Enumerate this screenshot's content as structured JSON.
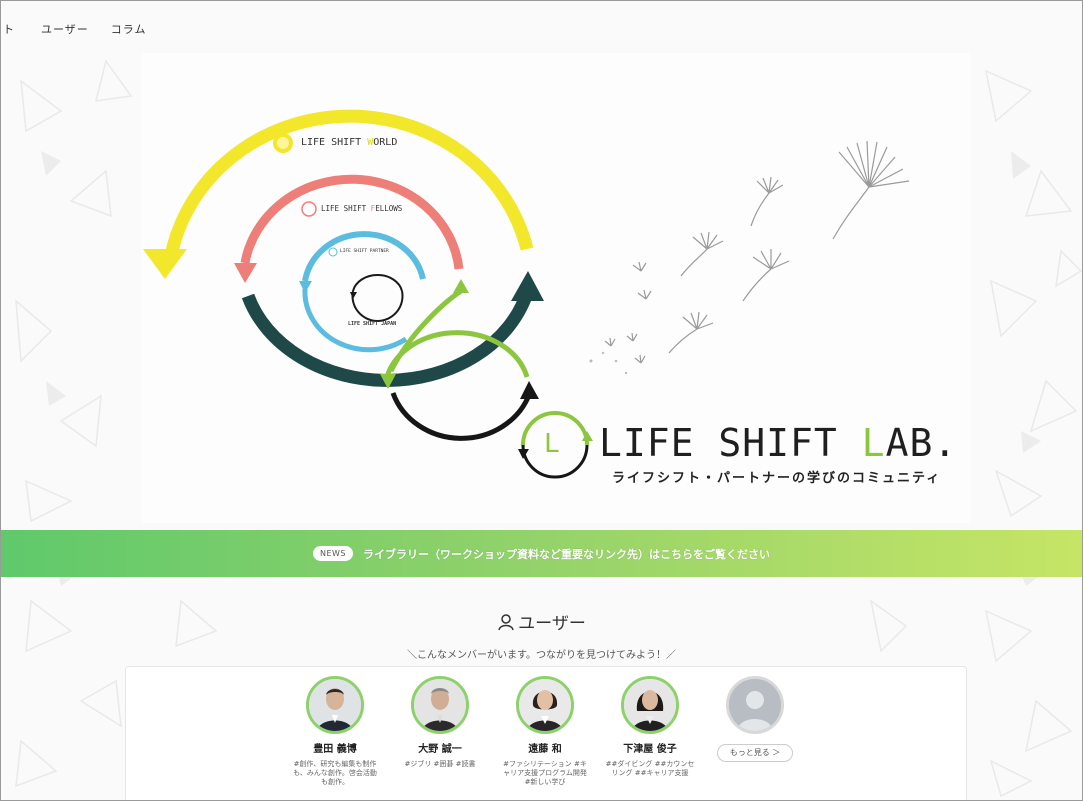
{
  "nav": {
    "cut_label": "ト",
    "items": [
      "ユーザー",
      "コラム"
    ]
  },
  "hero": {
    "rings": {
      "world": {
        "prefix": "LIFE SHIFT ",
        "accent": "W",
        "rest": "ORLD"
      },
      "fellows": {
        "prefix": "LIFE SHIFT ",
        "accent": "F",
        "rest": "ELLOWS"
      },
      "partner": "LIFE SHIFT PARTNER",
      "japan": "LIFE SHIFT JAPAN"
    },
    "lab_title_prefix": "LIFE SHIFT ",
    "lab_title_accent": "L",
    "lab_title_rest": "AB.",
    "lab_subtitle": "ライフシフト・パートナーの学びのコミュニティ",
    "logo_letter": "L"
  },
  "news": {
    "badge": "NEWS",
    "text": "ライブラリー（ワークショップ資料など重要なリンク先）はこちらをご覧ください"
  },
  "users": {
    "heading": "ユーザー",
    "tagline": "＼こんなメンバーがいます。つながりを見つけてみよう！／",
    "members": [
      {
        "name": "豊田 義博",
        "tags": "#創作、研究も編集も制作も、みんな創作。啓会活動も創作。"
      },
      {
        "name": "大野 誠一",
        "tags": "#ジブリ #囲碁 #読書"
      },
      {
        "name": "遠藤 和",
        "tags": "#ファシリテーション #キャリア支援プログラム開発 #新しい学び"
      },
      {
        "name": "下津屋 俊子",
        "tags": "##ダイビング ##カウンセリング ##キャリア支援"
      }
    ],
    "more_label": "もっと見る ＞"
  },
  "colors": {
    "yellow": "#f2e72a",
    "coral": "#ee7f78",
    "sky": "#5bbce0",
    "dark": "#1f4848",
    "green": "#8cc63f",
    "news_start": "#5fc96b",
    "news_end": "#c6e566"
  }
}
